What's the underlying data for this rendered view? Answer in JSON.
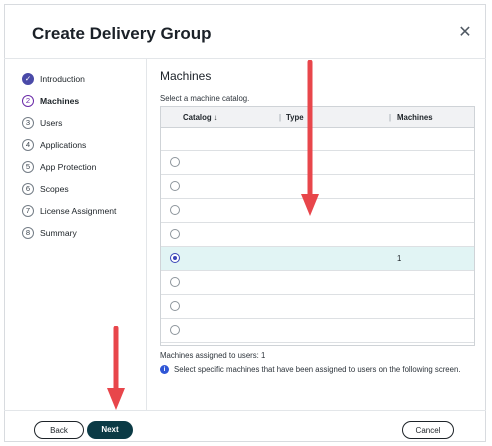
{
  "dialog": {
    "title": "Create Delivery Group",
    "close_glyph": "✕"
  },
  "steps": [
    {
      "num": "✓",
      "label": "Introduction",
      "state": "done"
    },
    {
      "num": "2",
      "label": "Machines",
      "state": "active"
    },
    {
      "num": "3",
      "label": "Users",
      "state": "pending"
    },
    {
      "num": "4",
      "label": "Applications",
      "state": "pending"
    },
    {
      "num": "5",
      "label": "App Protection",
      "state": "pending"
    },
    {
      "num": "6",
      "label": "Scopes",
      "state": "pending"
    },
    {
      "num": "7",
      "label": "License Assignment",
      "state": "pending"
    },
    {
      "num": "8",
      "label": "Summary",
      "state": "pending"
    }
  ],
  "main": {
    "title": "Machines",
    "subtitle": "Select a machine catalog.",
    "table": {
      "columns": [
        "Catalog ↓",
        "Type",
        "Machines"
      ],
      "sort_icon": "arrow-down-icon",
      "rows": [
        {
          "selected": false,
          "catalog": "",
          "type": "",
          "machines": ""
        },
        {
          "selected": false,
          "catalog": "",
          "type": "",
          "machines": ""
        },
        {
          "selected": false,
          "catalog": "",
          "type": "",
          "machines": ""
        },
        {
          "selected": false,
          "catalog": "",
          "type": "",
          "machines": ""
        },
        {
          "selected": true,
          "catalog": "",
          "type": "",
          "machines": "1"
        },
        {
          "selected": false,
          "catalog": "",
          "type": "",
          "machines": ""
        },
        {
          "selected": false,
          "catalog": "",
          "type": "",
          "machines": ""
        },
        {
          "selected": false,
          "catalog": "",
          "type": "",
          "machines": ""
        }
      ]
    },
    "assigned_text": "Machines assigned to users:  1",
    "info_glyph": "i",
    "info_text": "Select specific machines that have been assigned to users on the following screen."
  },
  "footer": {
    "back_label": "Back",
    "next_label": "Next",
    "cancel_label": "Cancel"
  },
  "colors": {
    "accent": "#0b3a45",
    "selected_row": "#e1f4f4",
    "annotation_arrow": "#e8464b"
  }
}
